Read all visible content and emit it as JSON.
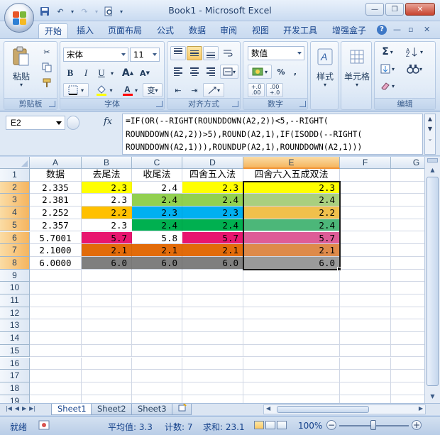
{
  "window": {
    "title": "Book1 - Microsoft Excel",
    "minimize_glyph": "—",
    "restore_glyph": "❐",
    "close_glyph": "✕"
  },
  "qat": {
    "save_icon": "save-icon",
    "undo_icon": "undo-icon",
    "redo_icon": "redo-icon",
    "preview_icon": "print-preview-icon"
  },
  "ribbon_tabs": [
    "开始",
    "插入",
    "页面布局",
    "公式",
    "数据",
    "审阅",
    "视图",
    "开发工具",
    "增强盒子"
  ],
  "ribbon_right": {
    "help": "?",
    "min": "—",
    "restore": "▫",
    "close": "✕"
  },
  "clipboard": {
    "paste_label": "粘贴",
    "group_label": "剪贴板"
  },
  "font": {
    "name": "宋体",
    "size": "11",
    "bold": "B",
    "italic": "I",
    "underline": "U",
    "grow": "A",
    "shrink": "A",
    "phonetic": "变",
    "group_label": "字体",
    "fill_color": "#ffff00",
    "font_color": "#ff0000"
  },
  "alignment": {
    "group_label": "对齐方式"
  },
  "number": {
    "format": "数值",
    "percent": "%",
    "comma": ",",
    "inc_dec": "+.0 .00",
    "dec_dec": ".00 +.0",
    "group_label": "数字"
  },
  "styles": {
    "label": "样式"
  },
  "cells": {
    "label": "单元格"
  },
  "editing": {
    "sum": "Σ",
    "group_label": "编辑"
  },
  "formula_bar": {
    "name_box": "E2",
    "fx": "fx",
    "formula_lines": [
      "=IF(OR(--RIGHT(ROUNDDOWN(A2,2))<5,--RIGHT(",
      "ROUNDDOWN(A2,2))>5),ROUND(A2,1),IF(ISODD(--RIGHT(",
      "ROUNDDOWN(A2,1))),ROUNDUP(A2,1),ROUNDDOWN(A2,1)))"
    ]
  },
  "grid": {
    "columns": [
      "A",
      "B",
      "C",
      "D",
      "E",
      "F",
      "G"
    ],
    "selected_column": "E",
    "rows": [
      "1",
      "2",
      "3",
      "4",
      "5",
      "6",
      "7",
      "8",
      "9",
      "10",
      "11",
      "12",
      "13",
      "14",
      "15",
      "16",
      "17",
      "18",
      "19"
    ],
    "selected_rows": [
      "2",
      "3",
      "4",
      "5",
      "6",
      "7",
      "8"
    ],
    "headers": [
      "数据",
      "去尾法",
      "收尾法",
      "四舍五入法",
      "四舍六入五成双法"
    ],
    "data": [
      [
        "2.335",
        "2.3",
        "2.4",
        "2.3",
        "2.3"
      ],
      [
        "2.381",
        "2.3",
        "2.4",
        "2.4",
        "2.4"
      ],
      [
        "2.252",
        "2.2",
        "2.3",
        "2.3",
        "2.2"
      ],
      [
        "2.357",
        "2.3",
        "2.4",
        "2.4",
        "2.4"
      ],
      [
        "5.7001",
        "5.7",
        "5.8",
        "5.7",
        "5.7"
      ],
      [
        "2.1000",
        "2.1",
        "2.1",
        "2.1",
        "2.1"
      ],
      [
        "6.0000",
        "6.0",
        "6.0",
        "6.0",
        "6.0"
      ]
    ],
    "row_fills": {
      "B": [
        "#ffff00",
        "#ffffff",
        "#ffc000",
        "#ffffff",
        "#e8156f",
        "#e26b0a",
        "#7f7f7f"
      ],
      "C": [
        "#ffffff",
        "#92d050",
        "#00b0f0",
        "#00b050",
        "#ffffff",
        "#e26b0a",
        "#7f7f7f"
      ],
      "D": [
        "#ffff00",
        "#92d050",
        "#00b0f0",
        "#00b050",
        "#e8156f",
        "#e26b0a",
        "#7f7f7f"
      ],
      "E": [
        "#ffff00",
        "#a9cf7f",
        "#f0c04c",
        "#4cb779",
        "#de5c97",
        "#de8a4a",
        "#9a9a9a"
      ]
    }
  },
  "sheets": [
    "Sheet1",
    "Sheet2",
    "Sheet3"
  ],
  "active_sheet": "Sheet1",
  "status": {
    "mode": "就绪",
    "average": "平均值: 3.3",
    "count": "计数: 7",
    "sum": "求和: 23.1",
    "zoom": "100%"
  }
}
